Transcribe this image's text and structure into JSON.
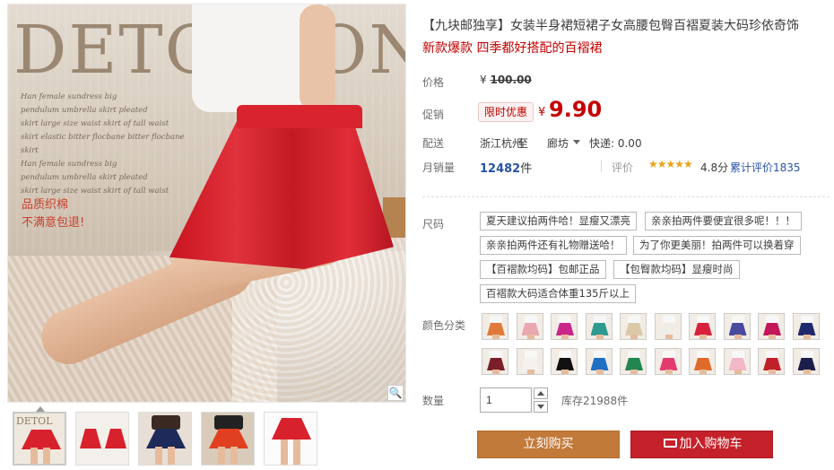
{
  "gallery": {
    "watermark_text": "DETOLLON",
    "script_lines": [
      "Han female sundress big",
      "pendulum umbrella skirt pleated",
      "skirt large size waist skirt of tall waist",
      "skirt elastic bitter flocbane bitter flocbane skirt",
      "Han female sundress big",
      "pendulum umbrella skirt pleated",
      "skirt large size waist skirt of tall waist"
    ],
    "promo_line1": "品质织棉",
    "promo_line2": "不满意包退!",
    "zoom_icon": "magnifier",
    "thumbnails": [
      "thumb-1",
      "thumb-2",
      "thumb-3",
      "thumb-4",
      "thumb-5"
    ],
    "thumbnail_text": "DETOL"
  },
  "product": {
    "title": "【九块邮独享】女装半身裙短裙子女高腰包臀百褶夏装大码珍依奇饰",
    "subtitle": "新款爆款 四季都好搭配的百褶裙"
  },
  "price": {
    "label": "价格",
    "currency": "¥",
    "original": "100.00",
    "promo_label": "促销",
    "promo_tag": "限时优惠",
    "current": "9.90"
  },
  "shipping": {
    "label": "配送",
    "from": "浙江杭州",
    "to_word": "至",
    "city": "廊坊",
    "fee": "快递: 0.00"
  },
  "sales": {
    "label": "月销量",
    "count": "12482",
    "unit": "件",
    "rating_label": "评价",
    "stars": "★★★★★",
    "score": "4.8分",
    "review_link": "累计评价1835"
  },
  "size": {
    "label": "尺码",
    "options": [
      "夏天建议拍两件哈！显瘦又漂亮",
      "亲亲拍两件要便宜很多呢！！！",
      "亲亲拍两件还有礼物赠送哈！",
      "为了你更美丽！拍两件可以换着穿",
      "【百褶款均码】包邮正品",
      "【包臀款均码】显瘦时尚",
      "百褶款大码适合体重135斤以上"
    ]
  },
  "color": {
    "label": "颜色分类",
    "swatch_colors": [
      "#e07a3a",
      "#e9a8b0",
      "#c9278a",
      "#2f9a8e",
      "#d9c9a8",
      "#f0ede8",
      "#d8213c",
      "#4a4aa0",
      "#c2185b",
      "#1f2a6e",
      "#7a1f2a",
      "#f4f1ee",
      "#111111",
      "#1f6fc2",
      "#21864f",
      "#e43a6d",
      "#e06a2a",
      "#f2b7c8",
      "#c0202a",
      "#1b1e4a"
    ]
  },
  "quantity": {
    "label": "数量",
    "value": "1",
    "stock": "库存21988件"
  },
  "actions": {
    "buy_now": "立刻购买",
    "add_to_cart": "加入购物车"
  },
  "colors": {
    "price_red": "#c40000",
    "buy_orange": "#c27a3a",
    "cart_red": "#c4212a",
    "link_blue": "#2953a6"
  }
}
